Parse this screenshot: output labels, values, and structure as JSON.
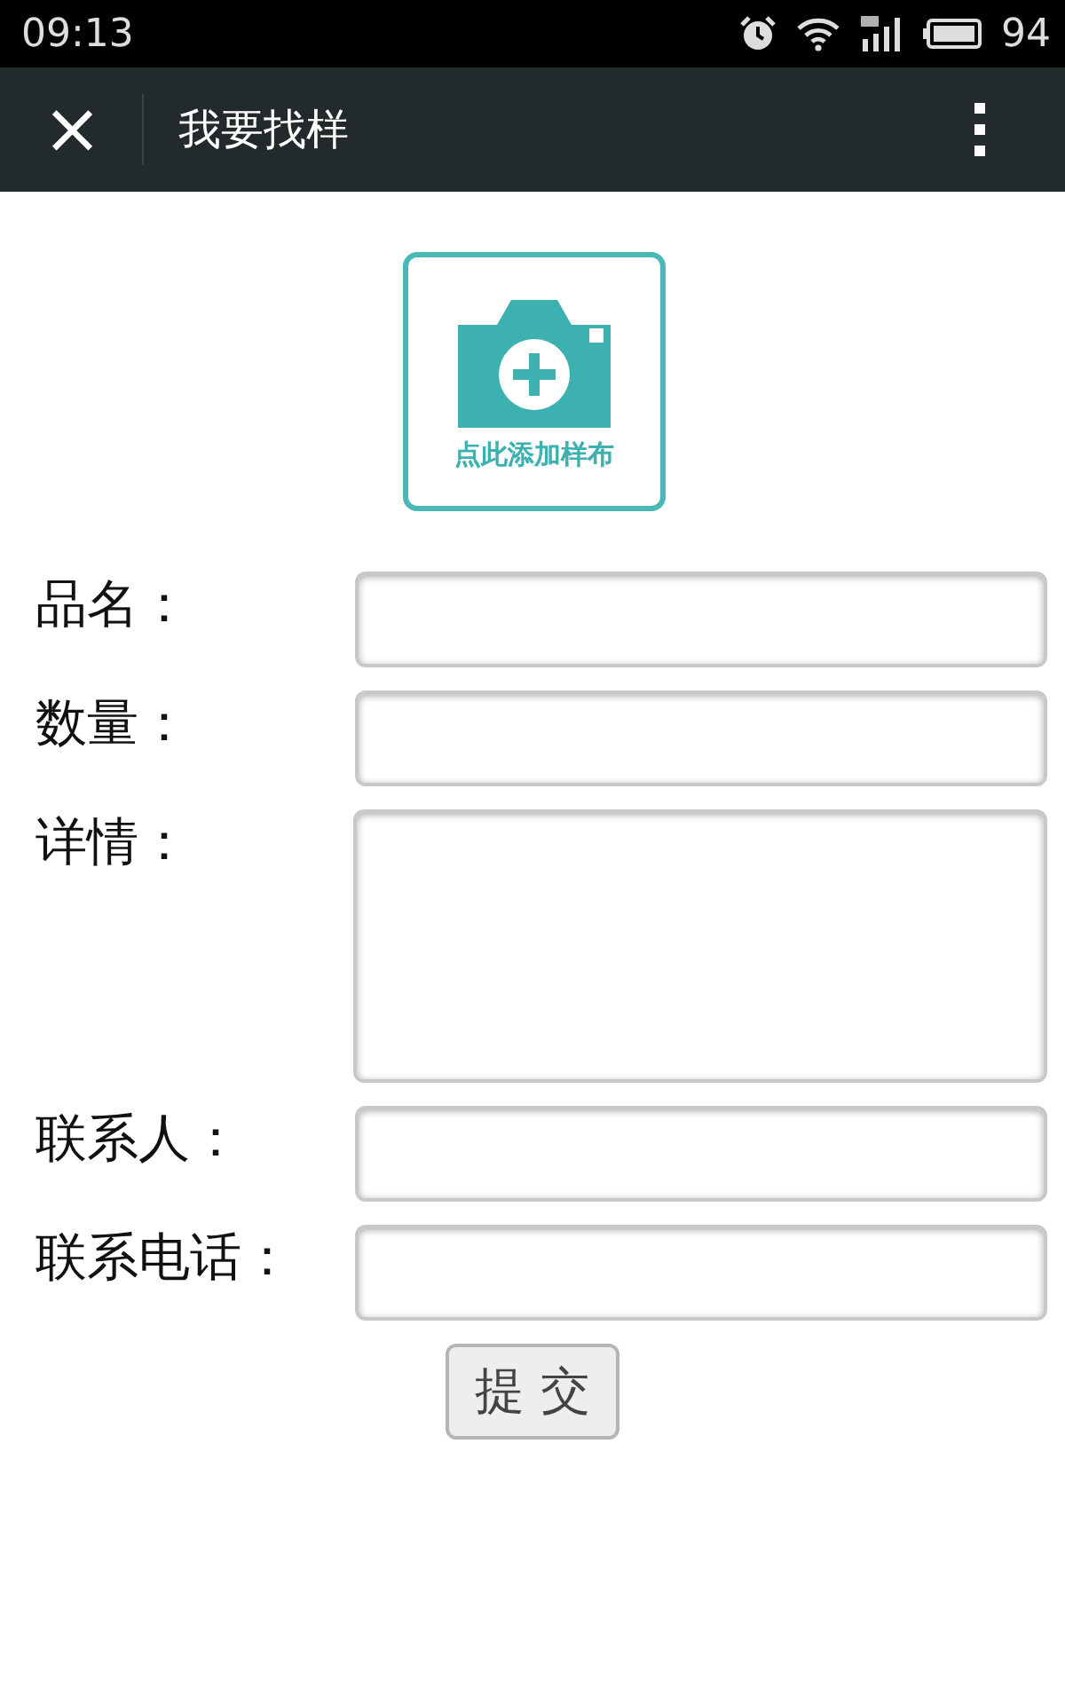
{
  "status_bar": {
    "time": "09:13",
    "battery": "94"
  },
  "title_bar": {
    "close": "×",
    "title": "我要找样"
  },
  "upload": {
    "label": "点此添加样布"
  },
  "fields": [
    {
      "label": "品名：",
      "kind": "input"
    },
    {
      "label": "数量：",
      "kind": "input"
    },
    {
      "label": "详情：",
      "kind": "textarea"
    },
    {
      "label": "联系人：",
      "kind": "input"
    },
    {
      "label": "联系电话：",
      "kind": "input"
    }
  ],
  "submit": "提 交"
}
